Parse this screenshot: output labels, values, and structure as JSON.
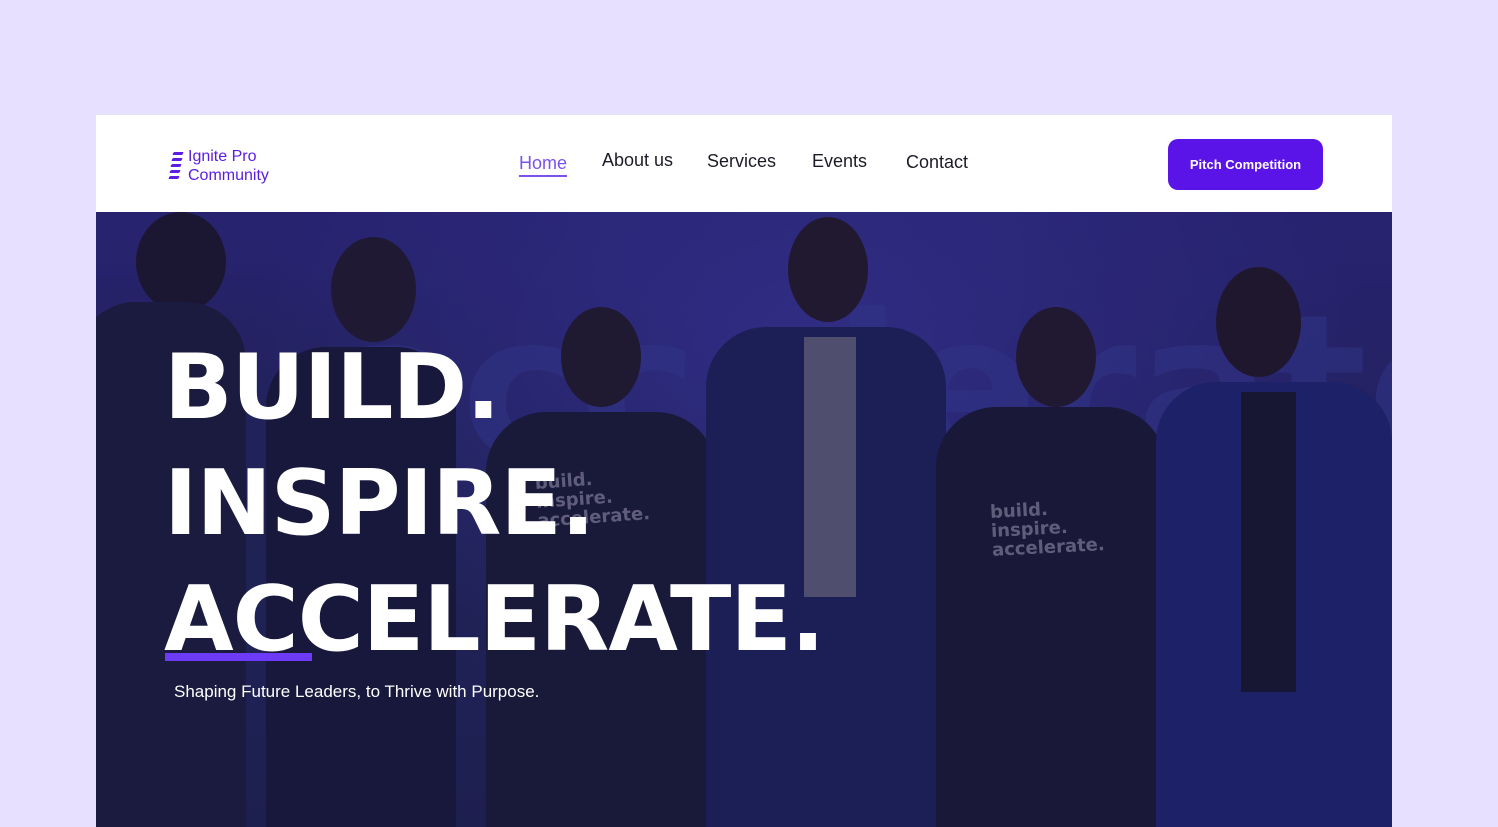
{
  "brand": {
    "line1": "Ignite Pro",
    "line2": "Community",
    "color": "#5b1ee0",
    "icon": "stacked-bars-logo-icon"
  },
  "nav": {
    "items": [
      {
        "label": "Home",
        "active": true
      },
      {
        "label": "About us",
        "active": false
      },
      {
        "label": "Services",
        "active": false
      },
      {
        "label": "Events",
        "active": false
      },
      {
        "label": "Contact",
        "active": false
      }
    ],
    "active_color": "#7b52f0",
    "cta_label": "Pitch Competition",
    "cta_color": "#5b14e8"
  },
  "hero": {
    "headline": [
      "BUILD.",
      "INSPIRE.",
      "ACCELERATE."
    ],
    "tagline": "Shaping Future Leaders, to Thrive with Purpose.",
    "accent_color": "#6d3bf5",
    "shirt_text": "build.\ninspire.\naccelerate.",
    "background_word": "accelerate"
  }
}
